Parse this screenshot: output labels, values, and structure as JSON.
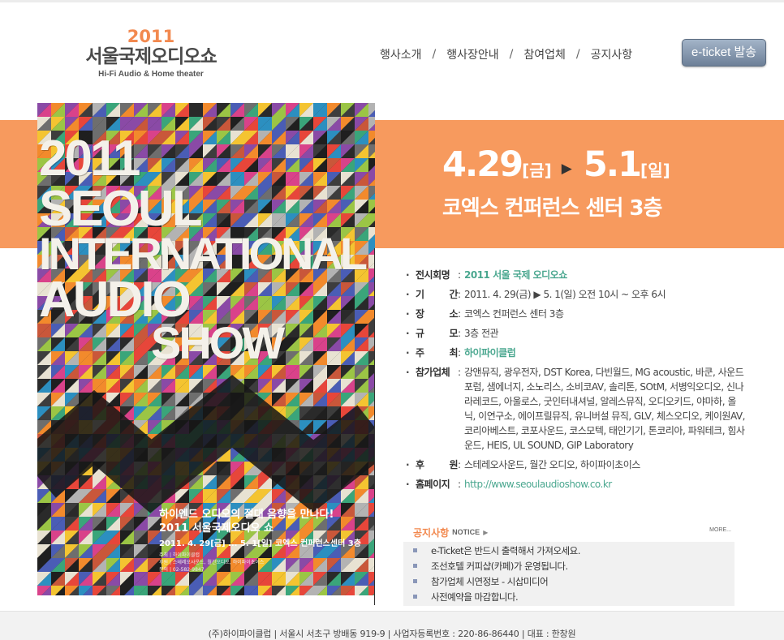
{
  "logo": {
    "year": "2011",
    "name": "서울국제오디오쇼",
    "subtitle": "Hi-Fi Audio & Home theater"
  },
  "nav": {
    "items": [
      "행사소개",
      "행사장안내",
      "참여업체",
      "공지사항"
    ],
    "separator": "/"
  },
  "eticket_button": "e-ticket 발송",
  "colors": {
    "accent_orange": "#f79a5e",
    "green_text": "#4aa78f",
    "logo_orange": "#f2894f"
  },
  "poster": {
    "title_lines": [
      "2011",
      "SEOUL",
      "INTERNATIONAL",
      "AUDIO",
      "SHOW"
    ],
    "slogan_line1": "하이엔드 오디오의 절대 음향을 만나다!",
    "slogan_line2": "2011 서울국제오디오 쇼",
    "dates": "2011. 4. 29[금] ... 5. 1[일] 코엑스 컨퍼런스센터 3층",
    "host": "주최 | 하이파이클럽",
    "sponsor": "후원 | 스테레오사운드, 월간오디오, 하이파이초이스",
    "contact": "문의 | 02-582-9847"
  },
  "event": {
    "start_date": "4.29",
    "start_day": "[금]",
    "arrow": "▶",
    "end_date": "5.1",
    "end_day": "[일]",
    "venue": "코엑스 컨퍼런스 센터 3층"
  },
  "info": {
    "bullet": "·",
    "name_label": "전시회명",
    "name_value": "2011 서울 국제 오디오쇼",
    "period_label": "기 간",
    "period_value": "2011. 4. 29(금) ▶ 5. 1(일)  오전 10시 ~ 오후 6시",
    "place_label": "장 소",
    "place_value": "코엑스 컨퍼런스 센터 3층",
    "scale_label": "규 모",
    "scale_value": "3층 전관",
    "host_label": "주 최",
    "host_value": "하이파이클럽",
    "exhibitors_label": "참가업체",
    "exhibitors_value": "강앤뮤직, 광우전자, DST Korea, 다빈월드, MG acoustic, 바쿤, 사운드포럼, 샘에너지, 소노리스, 소비코AV, 솔리톤, SOtM, 서병익오디오, 신나라레코드, 아울로스, 굿인터내셔널, 알레스뮤직, 오디오키드, 야마하, 올닉, 이연구소, 에이프릴뮤직, 유니버설 뮤직, GLV, 체스오디오, 케이원AV, 코리아베스트, 코포사운드, 코스모텍, 태인기기, 톤코리아, 파워테크, 힘사운드, HEIS, UL SOUND, GIP Laboratory",
    "sponsor_label": "후 원",
    "sponsor_value": "스테레오사운드, 월간 오디오, 하이파이초이스",
    "homepage_label": "홈페이지",
    "homepage_value": "http://www.seoulaudioshow.co.kr",
    "colon": ":"
  },
  "notice": {
    "title": "공지사항",
    "title_en": "NOTICE",
    "arrow": "▶",
    "more": "MORE...",
    "items": [
      "e-Ticket은 반드시 출력해서 가져오세요.",
      "조선호텔 커피샵(카페)가 운영됩니다.",
      "참가업체 시연정보 - 시삽미디어",
      "사전예약을 마감합니다."
    ]
  },
  "footer": {
    "text": "(주)하이파이클럽 | 서울시 서초구 방배동 919-9 | 사업자등록번호 : 220-86-86440 | 대표 : 한창원"
  }
}
